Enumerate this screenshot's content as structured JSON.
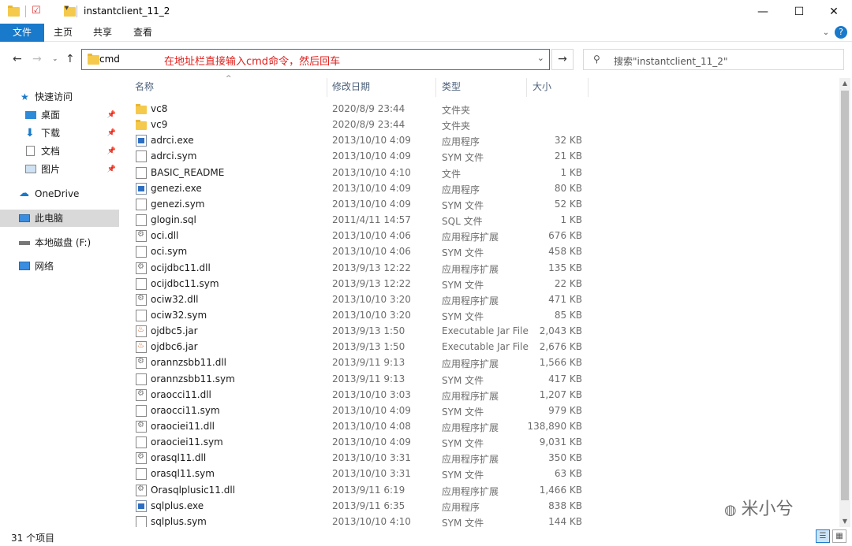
{
  "window": {
    "title": "instantclient_11_2",
    "minimize": "—",
    "maximize": "☐",
    "close": "✕"
  },
  "ribbon": {
    "tabs": [
      "文件",
      "主页",
      "共享",
      "查看"
    ]
  },
  "address": {
    "value": "cmd",
    "annotation": "在地址栏直接输入cmd命令，然后回车",
    "go_symbol": "→"
  },
  "search": {
    "placeholder": "搜索\"instantclient_11_2\""
  },
  "nav": {
    "quick_access": "快速访问",
    "pinned": [
      "桌面",
      "下载",
      "文档",
      "图片"
    ],
    "onedrive": "OneDrive",
    "this_pc": "此电脑",
    "local_disk": "本地磁盘 (F:)",
    "network": "网络"
  },
  "columns": {
    "name": "名称",
    "date": "修改日期",
    "type": "类型",
    "size": "大小"
  },
  "files": [
    {
      "name": "vc8",
      "date": "2020/8/9 23:44",
      "type": "文件夹",
      "size": "",
      "icon": "folder"
    },
    {
      "name": "vc9",
      "date": "2020/8/9 23:44",
      "type": "文件夹",
      "size": "",
      "icon": "folder"
    },
    {
      "name": "adrci.exe",
      "date": "2013/10/10 4:09",
      "type": "应用程序",
      "size": "32 KB",
      "icon": "exe"
    },
    {
      "name": "adrci.sym",
      "date": "2013/10/10 4:09",
      "type": "SYM 文件",
      "size": "21 KB",
      "icon": "doc"
    },
    {
      "name": "BASIC_README",
      "date": "2013/10/10 4:10",
      "type": "文件",
      "size": "1 KB",
      "icon": "doc"
    },
    {
      "name": "genezi.exe",
      "date": "2013/10/10 4:09",
      "type": "应用程序",
      "size": "80 KB",
      "icon": "exe"
    },
    {
      "name": "genezi.sym",
      "date": "2013/10/10 4:09",
      "type": "SYM 文件",
      "size": "52 KB",
      "icon": "doc"
    },
    {
      "name": "glogin.sql",
      "date": "2011/4/11 14:57",
      "type": "SQL 文件",
      "size": "1 KB",
      "icon": "doc"
    },
    {
      "name": "oci.dll",
      "date": "2013/10/10 4:06",
      "type": "应用程序扩展",
      "size": "676 KB",
      "icon": "dll"
    },
    {
      "name": "oci.sym",
      "date": "2013/10/10 4:06",
      "type": "SYM 文件",
      "size": "458 KB",
      "icon": "doc"
    },
    {
      "name": "ocijdbc11.dll",
      "date": "2013/9/13 12:22",
      "type": "应用程序扩展",
      "size": "135 KB",
      "icon": "dll"
    },
    {
      "name": "ocijdbc11.sym",
      "date": "2013/9/13 12:22",
      "type": "SYM 文件",
      "size": "22 KB",
      "icon": "doc"
    },
    {
      "name": "ociw32.dll",
      "date": "2013/10/10 3:20",
      "type": "应用程序扩展",
      "size": "471 KB",
      "icon": "dll"
    },
    {
      "name": "ociw32.sym",
      "date": "2013/10/10 3:20",
      "type": "SYM 文件",
      "size": "85 KB",
      "icon": "doc"
    },
    {
      "name": "ojdbc5.jar",
      "date": "2013/9/13 1:50",
      "type": "Executable Jar File",
      "size": "2,043 KB",
      "icon": "jar"
    },
    {
      "name": "ojdbc6.jar",
      "date": "2013/9/13 1:50",
      "type": "Executable Jar File",
      "size": "2,676 KB",
      "icon": "jar"
    },
    {
      "name": "orannzsbb11.dll",
      "date": "2013/9/11 9:13",
      "type": "应用程序扩展",
      "size": "1,566 KB",
      "icon": "dll"
    },
    {
      "name": "orannzsbb11.sym",
      "date": "2013/9/11 9:13",
      "type": "SYM 文件",
      "size": "417 KB",
      "icon": "doc"
    },
    {
      "name": "oraocci11.dll",
      "date": "2013/10/10 3:03",
      "type": "应用程序扩展",
      "size": "1,207 KB",
      "icon": "dll"
    },
    {
      "name": "oraocci11.sym",
      "date": "2013/10/10 4:09",
      "type": "SYM 文件",
      "size": "979 KB",
      "icon": "doc"
    },
    {
      "name": "oraociei11.dll",
      "date": "2013/10/10 4:08",
      "type": "应用程序扩展",
      "size": "138,890 KB",
      "icon": "dll"
    },
    {
      "name": "oraociei11.sym",
      "date": "2013/10/10 4:09",
      "type": "SYM 文件",
      "size": "9,031 KB",
      "icon": "doc"
    },
    {
      "name": "orasql11.dll",
      "date": "2013/10/10 3:31",
      "type": "应用程序扩展",
      "size": "350 KB",
      "icon": "dll"
    },
    {
      "name": "orasql11.sym",
      "date": "2013/10/10 3:31",
      "type": "SYM 文件",
      "size": "63 KB",
      "icon": "doc"
    },
    {
      "name": "Orasqlplusic11.dll",
      "date": "2013/9/11 6:19",
      "type": "应用程序扩展",
      "size": "1,466 KB",
      "icon": "dll"
    },
    {
      "name": "sqlplus.exe",
      "date": "2013/9/11 6:35",
      "type": "应用程序",
      "size": "838 KB",
      "icon": "exe"
    },
    {
      "name": "sqlplus.sym",
      "date": "2013/10/10 4:10",
      "type": "SYM 文件",
      "size": "144 KB",
      "icon": "doc"
    }
  ],
  "status": {
    "count": "31 个项目"
  },
  "watermark": "米小兮",
  "colors": {
    "accent": "#1979ca",
    "annotation": "#e0201c",
    "header_text": "#4c607a"
  }
}
